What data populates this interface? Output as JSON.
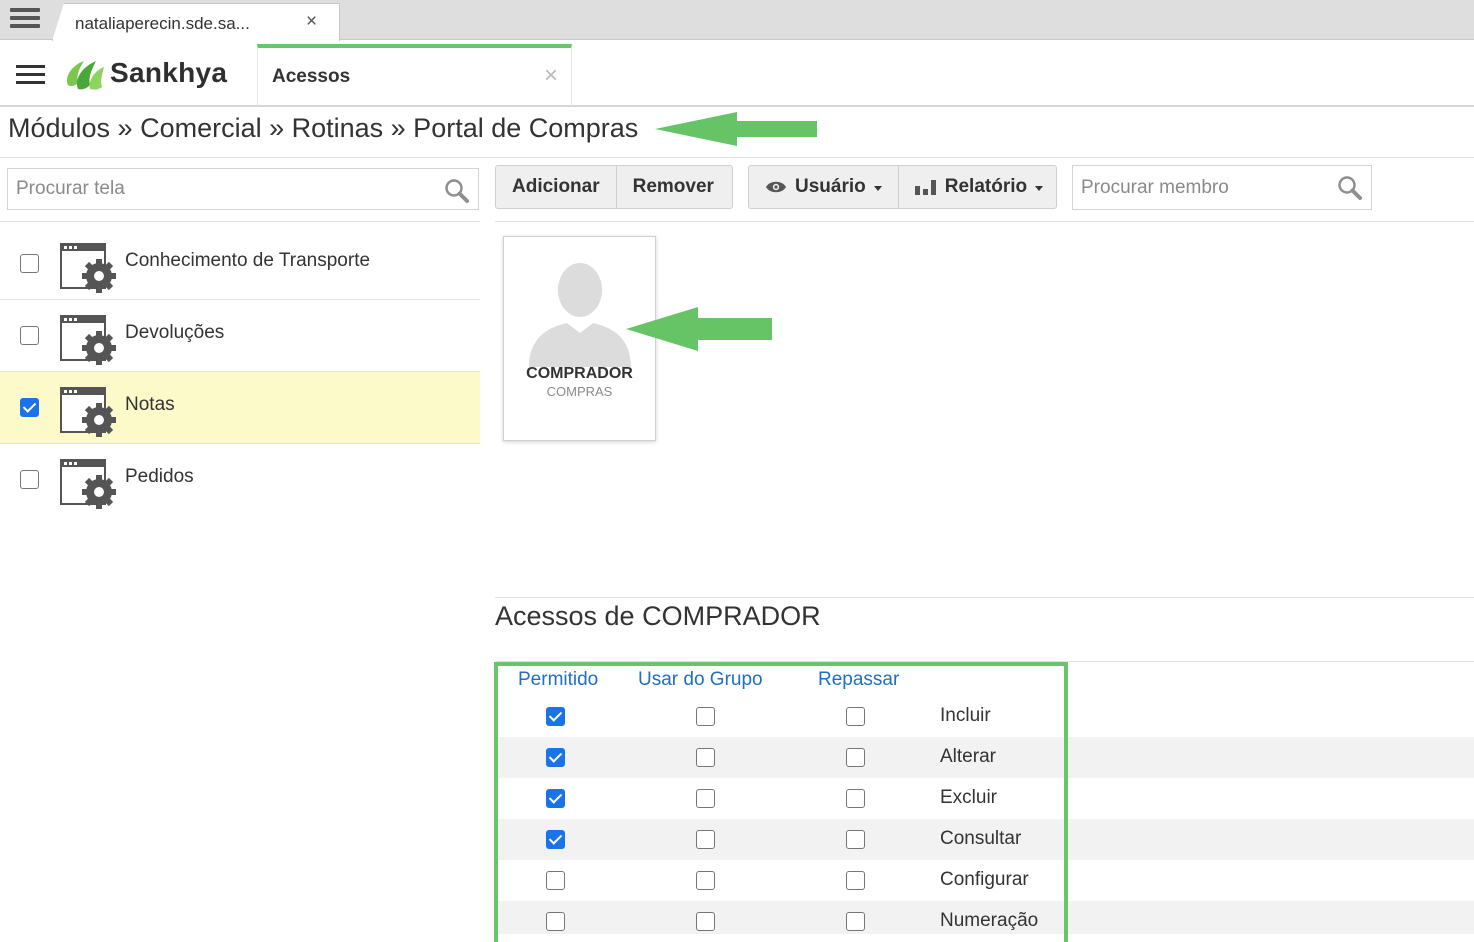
{
  "browser": {
    "tab_title": "nataliaperecin.sde.sa...",
    "tab_close": "×"
  },
  "app": {
    "logo_text": "Sankhya",
    "tab_label": "Acessos",
    "tab_close": "×"
  },
  "breadcrumb": "Módulos » Comercial » Rotinas » Portal de Compras",
  "left_panel": {
    "search_placeholder": "Procurar tela",
    "items": [
      {
        "label": "Conhecimento de Transporte",
        "checked": false
      },
      {
        "label": "Devoluções",
        "checked": false
      },
      {
        "label": "Notas",
        "checked": true
      },
      {
        "label": "Pedidos",
        "checked": false
      }
    ]
  },
  "toolbar": {
    "add_label": "Adicionar",
    "remove_label": "Remover",
    "user_label": "Usuário",
    "report_label": "Relatório",
    "member_search_placeholder": "Procurar membro"
  },
  "member": {
    "name": "COMPRADOR",
    "group": "COMPRAS"
  },
  "access": {
    "title": "Acessos de COMPRADOR",
    "columns": [
      "Permitido",
      "Usar do Grupo",
      "Repassar"
    ],
    "rows": [
      {
        "label": "Incluir",
        "permitido": true,
        "usar_grupo": false,
        "repassar": false
      },
      {
        "label": "Alterar",
        "permitido": true,
        "usar_grupo": false,
        "repassar": false
      },
      {
        "label": "Excluir",
        "permitido": true,
        "usar_grupo": false,
        "repassar": false
      },
      {
        "label": "Consultar",
        "permitido": true,
        "usar_grupo": false,
        "repassar": false
      },
      {
        "label": "Configurar",
        "permitido": false,
        "usar_grupo": false,
        "repassar": false
      },
      {
        "label": "Numeração",
        "permitido": false,
        "usar_grupo": false,
        "repassar": false
      }
    ]
  },
  "colors": {
    "annotation_green": "#66c466",
    "check_blue": "#1a73e8",
    "link_blue": "#1f6fc4",
    "selected_row": "#fcfac8"
  }
}
